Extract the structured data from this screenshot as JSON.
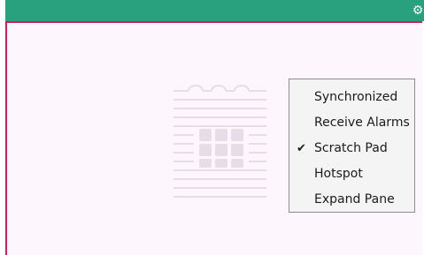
{
  "window": {
    "settings_icon": "gear-icon",
    "title_bar_color": "#2aa17e",
    "border_color": "#d81b60"
  },
  "content": {
    "illustration": "notepad-icon"
  },
  "menu": {
    "items": [
      {
        "label": "Synchronized",
        "checked": false
      },
      {
        "label": "Receive Alarms",
        "checked": false
      },
      {
        "label": "Scratch Pad",
        "checked": true
      },
      {
        "label": "Hotspot",
        "checked": false
      },
      {
        "label": "Expand Pane",
        "checked": false
      }
    ],
    "check_glyph": "✔"
  }
}
